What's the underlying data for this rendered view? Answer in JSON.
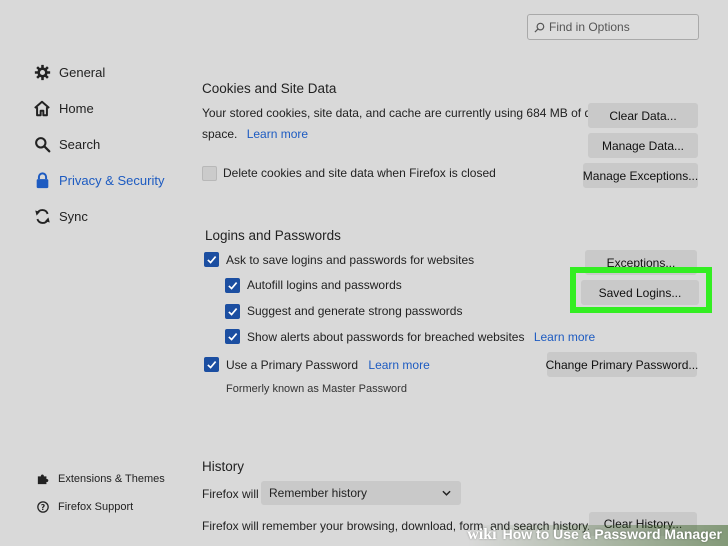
{
  "search": {
    "placeholder": "Find in Options"
  },
  "sidebar": {
    "items": [
      {
        "label": "General",
        "icon": "gear-icon"
      },
      {
        "label": "Home",
        "icon": "home-icon"
      },
      {
        "label": "Search",
        "icon": "search-icon"
      },
      {
        "label": "Privacy & Security",
        "icon": "lock-icon",
        "active": true
      },
      {
        "label": "Sync",
        "icon": "sync-icon"
      }
    ],
    "footer": [
      {
        "label": "Extensions & Themes",
        "icon": "puzzle-icon"
      },
      {
        "label": "Firefox Support",
        "icon": "help-icon"
      }
    ]
  },
  "cookies": {
    "title": "Cookies and Site Data",
    "desc_line1": "Your stored cookies, site data, and cache are currently using 684 MB of disk",
    "desc_line2": "space.",
    "learn_more": "Learn more",
    "delete_label": "Delete cookies and site data when Firefox is closed",
    "delete_checked": false,
    "clear_data": "Clear Data...",
    "manage_data": "Manage Data...",
    "manage_exceptions": "Manage Exceptions..."
  },
  "logins": {
    "title": "Logins and Passwords",
    "ask_save": "Ask to save logins and passwords for websites",
    "autofill": "Autofill logins and passwords",
    "suggest": "Suggest and generate strong passwords",
    "alerts": "Show alerts about passwords for breached websites",
    "alerts_learn_more": "Learn more",
    "primary_password": "Use a Primary Password",
    "primary_learn_more": "Learn more",
    "formerly": "Formerly known as Master Password",
    "exceptions": "Exceptions...",
    "saved_logins": "Saved Logins...",
    "change_primary": "Change Primary Password..."
  },
  "history": {
    "title": "History",
    "will_label": "Firefox will",
    "select_value": "Remember history",
    "desc": "Firefox will remember your browsing, download, form, and search history.",
    "clear_history": "Clear History..."
  },
  "watermark": {
    "brand": "wiki",
    "text": "How to Use a Password Manager"
  },
  "colors": {
    "accent": "#1d5bc1",
    "checkbox": "#1b4ea1",
    "highlight": "#33ee22",
    "background": "#d9d9d9"
  }
}
